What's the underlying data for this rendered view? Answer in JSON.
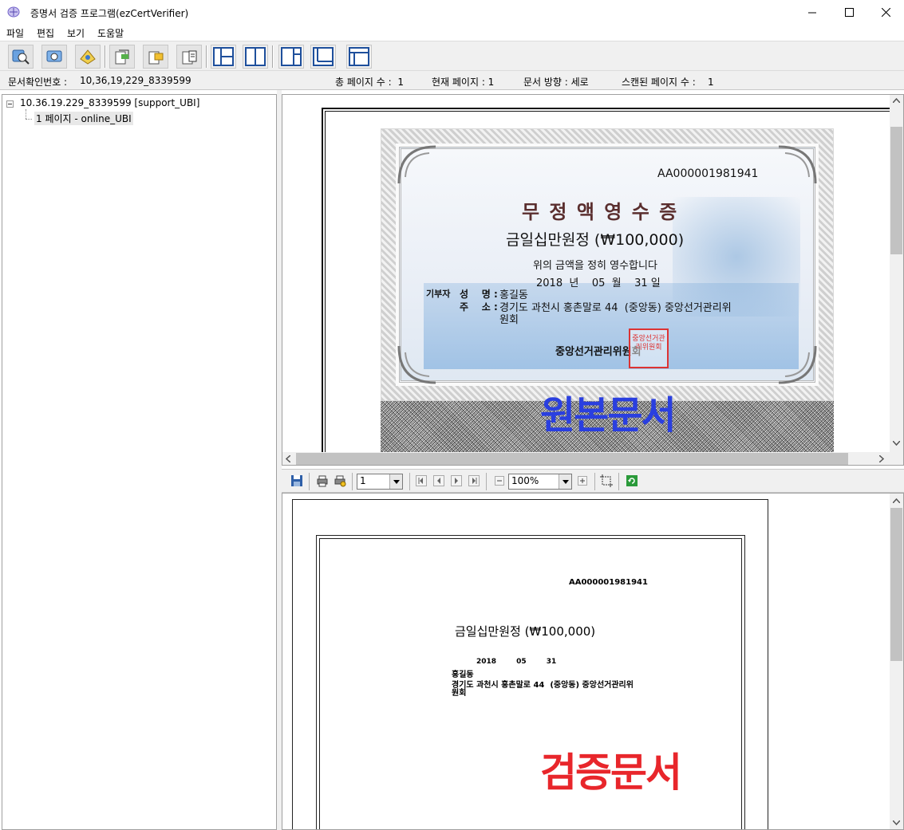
{
  "window": {
    "title": "증명서 검증 프로그램(ezCertVerifier)"
  },
  "menu": [
    "파일",
    "편집",
    "보기",
    "도움말"
  ],
  "toolbar": {
    "icons": [
      "search-tool-icon",
      "view-tool-icon",
      "verify-tool-icon",
      "scan-tool-icon",
      "folder-tool-icon",
      "document-tool-icon",
      "layout-split-icon",
      "layout-columns-icon",
      "layout-left-icon",
      "layout-bottom-icon",
      "layout-top-icon"
    ]
  },
  "status": {
    "doc_id_label": "문서확인번호 :",
    "doc_id": "10,36,19,229_8339599",
    "total_pages": "총 페이지 수 :  1",
    "current_page": "현재 페이지 : 1",
    "orientation": "문서 방향 : 세로",
    "scanned_pages": "스캔된 페이지 수 :    1"
  },
  "tree": {
    "root": "10.36.19.229_8339599 [support_UBI]",
    "child": "1 페이지 - online_UBI"
  },
  "original": {
    "serial": "AA000001981941",
    "heading": "무 정 액 영 수 증",
    "amount": "금일십만원정 (₩100,000)",
    "statement": "위의 금액을 정히 영수합니다",
    "date": "2018  년    05  월    31 일",
    "donor_label": "기부자",
    "name_label": "성    명 :",
    "name": "홍길동",
    "address_label": "주    소 :",
    "address_line1": "경기도 과천시 홍촌말로 44  (중앙동) 중앙선거관리위",
    "address_line2": "원회",
    "issuer": "중앙선거관리위원회",
    "seal": "중앙선거관리위원회",
    "stamp": "원본문서"
  },
  "report_toolbar": {
    "page_value": "1",
    "zoom_value": "100%"
  },
  "verification": {
    "serial": "AA000001981941",
    "amount": "금일십만원정 (₩100,000)",
    "date": "2018        05        31",
    "name": "홍길동",
    "address_line1": "경기도 과천시 홍촌말로 44  (중앙동) 중앙선거관리위",
    "address_line2": "원회",
    "stamp": "검증문서"
  },
  "colors": {
    "original_stamp": "#2a3fe0",
    "verification_stamp": "#e8262b"
  }
}
